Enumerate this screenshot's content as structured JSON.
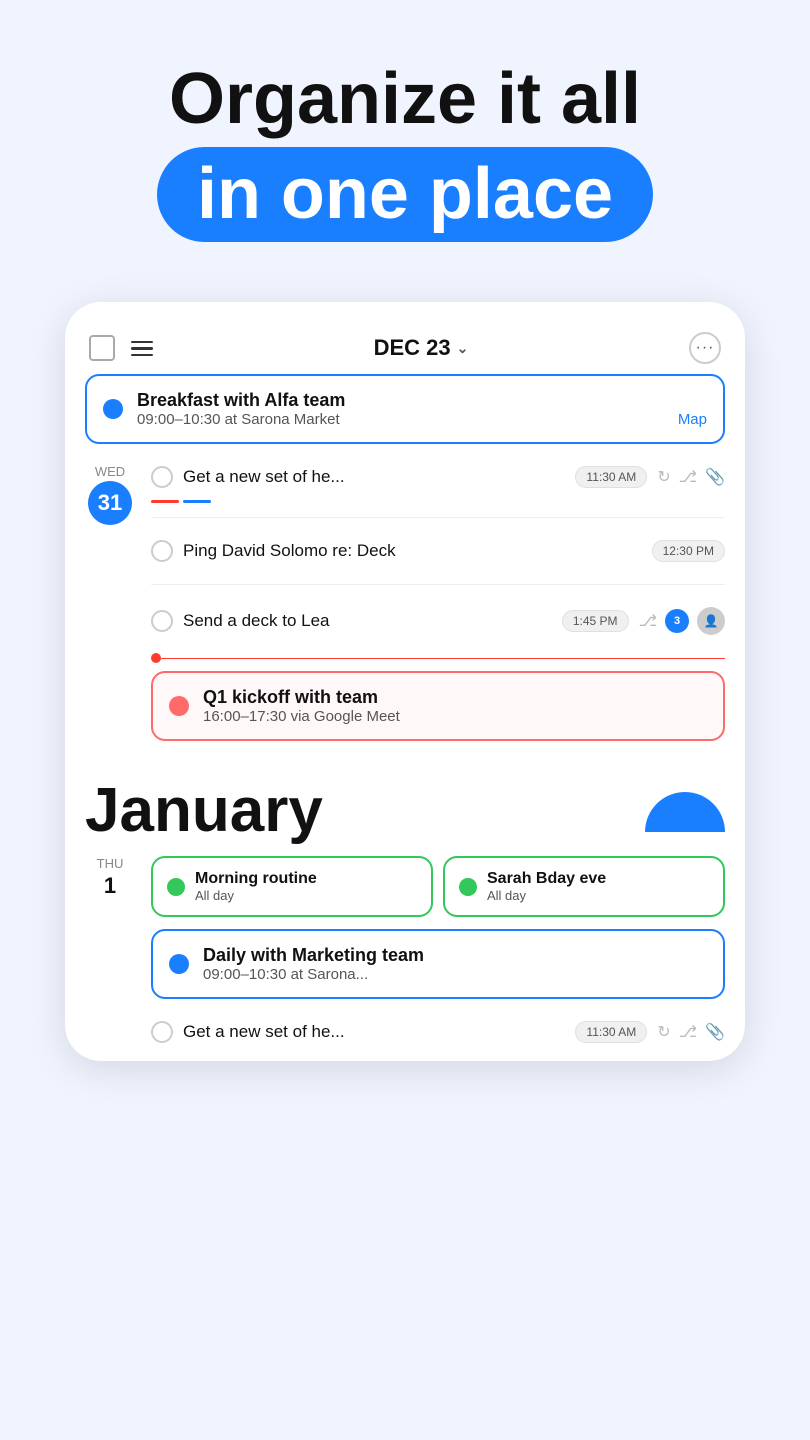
{
  "hero": {
    "line1": "Organize it all",
    "line2": "in one place"
  },
  "topbar": {
    "date": "DEC 23",
    "chevron": "⌄",
    "more": "···"
  },
  "dec_event": {
    "title": "Breakfast with Alfa team",
    "subtitle": "09:00–10:30 at Sarona Market",
    "map_label": "Map"
  },
  "wed_day": {
    "day_name": "WED",
    "day_number": "31"
  },
  "tasks": [
    {
      "text": "Get a new set of he...",
      "time": "11:30 AM",
      "has_underlines": true,
      "has_icons": true
    },
    {
      "text": "Ping David Solomo re: Deck",
      "time": "12:30 PM",
      "has_underlines": false,
      "has_icons": false
    },
    {
      "text": "Send a deck to Lea",
      "time": "1:45 PM",
      "has_underlines": false,
      "has_icons": true,
      "has_avatar": true,
      "bubble_count": "3"
    }
  ],
  "q1_event": {
    "title": "Q1 kickoff with team",
    "subtitle": "16:00–17:30 via Google Meet"
  },
  "january": {
    "month": "January"
  },
  "thu_day": {
    "day_name": "THU",
    "day_number": "1"
  },
  "green_events": [
    {
      "title": "Morning routine",
      "subtitle": "All day"
    },
    {
      "title": "Sarah Bday eve",
      "subtitle": "All day"
    }
  ],
  "daily_event": {
    "title": "Daily with Marketing team",
    "subtitle": "09:00–10:30 at Sarona..."
  },
  "bottom_task": {
    "text": "Get a new set of he...",
    "time": "11:30 AM"
  }
}
